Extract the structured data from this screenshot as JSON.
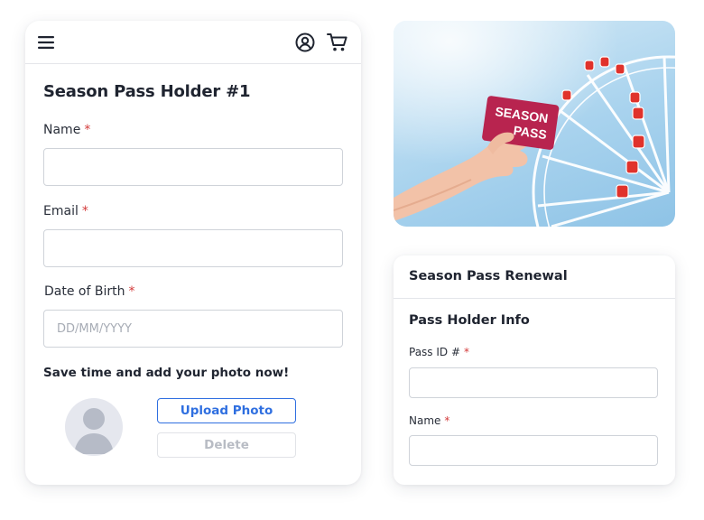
{
  "holder_form": {
    "title": "Season Pass Holder #1",
    "required_marker": "*",
    "name_label": "Name",
    "name_value": "",
    "email_label": "Email",
    "email_value": "",
    "dob_label": "Date of Birth",
    "dob_placeholder": "DD/MM/YYYY",
    "dob_value": "",
    "photo_hint": "Save time and add your photo now!",
    "upload_label": "Upload Photo",
    "delete_label": "Delete"
  },
  "topbar": {
    "icons": [
      "menu-icon",
      "account-icon",
      "cart-icon"
    ]
  },
  "hero": {
    "card_line1": "SEASON",
    "card_line2": "PASS"
  },
  "renewal": {
    "title": "Season Pass Renewal",
    "section": "Pass Holder Info",
    "pass_id_label": "Pass ID #",
    "pass_id_value": "",
    "name_label": "Name",
    "name_value": "",
    "required_marker": "*"
  },
  "colors": {
    "accent": "#2f6fe0",
    "required": "#d33a3a",
    "pass_card": "#b8244f",
    "ferris_cabin": "#e0322b"
  }
}
